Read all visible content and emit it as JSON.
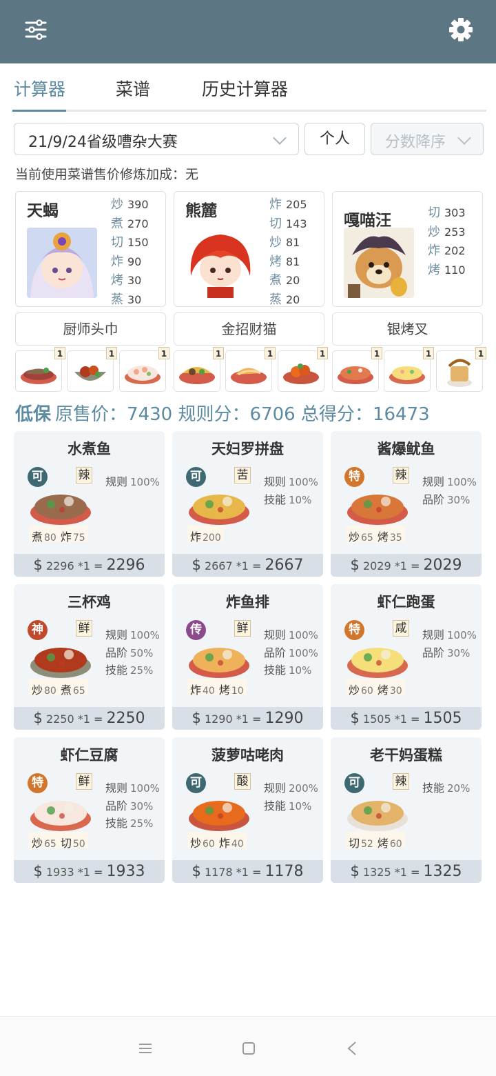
{
  "tabs": [
    "计算器",
    "菜谱",
    "历史计算器"
  ],
  "controls": {
    "rule_select": "21/9/24省级嘈杂大赛",
    "mode_button": "个人",
    "sort_select": "分数降序"
  },
  "bonus_note": "当前使用菜谱售价修炼加成：无",
  "chefs": [
    {
      "name": "天蝎",
      "skills": [
        {
          "k": "炒",
          "v": "390"
        },
        {
          "k": "煮",
          "v": "270"
        },
        {
          "k": "切",
          "v": "150"
        },
        {
          "k": "炸",
          "v": "90"
        },
        {
          "k": "烤",
          "v": "30"
        },
        {
          "k": "蒸",
          "v": "30"
        }
      ]
    },
    {
      "name": "熊麓",
      "skills": [
        {
          "k": "炸",
          "v": "205"
        },
        {
          "k": "切",
          "v": "143"
        },
        {
          "k": "炒",
          "v": "81"
        },
        {
          "k": "烤",
          "v": "81"
        },
        {
          "k": "煮",
          "v": "20"
        },
        {
          "k": "蒸",
          "v": "20"
        }
      ]
    },
    {
      "name": "嘎喵汪",
      "skills": [
        {
          "k": "切",
          "v": "303"
        },
        {
          "k": "炒",
          "v": "253"
        },
        {
          "k": "炸",
          "v": "202"
        },
        {
          "k": "烤",
          "v": "110"
        }
      ]
    }
  ],
  "equipment": [
    "厨师头巾",
    "金招财猫",
    "银烤叉"
  ],
  "ingredient_counts": [
    "1",
    "1",
    "1",
    "1",
    "1",
    "1",
    "1",
    "1",
    "1"
  ],
  "summary": {
    "label": "低保",
    "orig_label": "原售价：",
    "orig": "7430",
    "rule_label": "规则分：",
    "rule": "6706",
    "total_label": "总得分：",
    "total": "16473"
  },
  "recipes": [
    {
      "name": "水煮鱼",
      "rank": "可",
      "taste": "辣",
      "bonuses": [
        {
          "k": "规则",
          "p": "100%"
        }
      ],
      "req": [
        {
          "k": "煮",
          "v": "80"
        },
        {
          "k": "炸",
          "v": "75"
        }
      ],
      "price": "2296",
      "mult": "*1",
      "total": "2296"
    },
    {
      "name": "天妇罗拼盘",
      "rank": "可",
      "taste": "苦",
      "bonuses": [
        {
          "k": "规则",
          "p": "100%"
        },
        {
          "k": "技能",
          "p": "10%"
        }
      ],
      "req": [
        {
          "k": "炸",
          "v": "200"
        }
      ],
      "price": "2667",
      "mult": "*1",
      "total": "2667"
    },
    {
      "name": "酱爆鱿鱼",
      "rank": "特",
      "taste": "辣",
      "bonuses": [
        {
          "k": "规则",
          "p": "100%"
        },
        {
          "k": "品阶",
          "p": "30%"
        }
      ],
      "req": [
        {
          "k": "炒",
          "v": "65"
        },
        {
          "k": "烤",
          "v": "35"
        }
      ],
      "price": "2029",
      "mult": "*1",
      "total": "2029"
    },
    {
      "name": "三杯鸡",
      "rank": "神",
      "taste": "鲜",
      "bonuses": [
        {
          "k": "规则",
          "p": "100%"
        },
        {
          "k": "品阶",
          "p": "50%"
        },
        {
          "k": "技能",
          "p": "25%"
        }
      ],
      "req": [
        {
          "k": "炒",
          "v": "80"
        },
        {
          "k": "煮",
          "v": "65"
        }
      ],
      "price": "2250",
      "mult": "*1",
      "total": "2250"
    },
    {
      "name": "炸鱼排",
      "rank": "传",
      "taste": "鲜",
      "bonuses": [
        {
          "k": "规则",
          "p": "100%"
        },
        {
          "k": "品阶",
          "p": "100%"
        },
        {
          "k": "技能",
          "p": "10%"
        }
      ],
      "req": [
        {
          "k": "炸",
          "v": "40"
        },
        {
          "k": "烤",
          "v": "10"
        }
      ],
      "price": "1290",
      "mult": "*1",
      "total": "1290"
    },
    {
      "name": "虾仁跑蛋",
      "rank": "特",
      "taste": "咸",
      "bonuses": [
        {
          "k": "规则",
          "p": "100%"
        },
        {
          "k": "品阶",
          "p": "30%"
        }
      ],
      "req": [
        {
          "k": "炒",
          "v": "60"
        },
        {
          "k": "烤",
          "v": "30"
        }
      ],
      "price": "1505",
      "mult": "*1",
      "total": "1505"
    },
    {
      "name": "虾仁豆腐",
      "rank": "特",
      "taste": "鲜",
      "bonuses": [
        {
          "k": "规则",
          "p": "100%"
        },
        {
          "k": "品阶",
          "p": "30%"
        },
        {
          "k": "技能",
          "p": "25%"
        }
      ],
      "req": [
        {
          "k": "炒",
          "v": "65"
        },
        {
          "k": "切",
          "v": "50"
        }
      ],
      "price": "1933",
      "mult": "*1",
      "total": "1933"
    },
    {
      "name": "菠萝咕咾肉",
      "rank": "可",
      "taste": "酸",
      "bonuses": [
        {
          "k": "规则",
          "p": "200%"
        },
        {
          "k": "技能",
          "p": "10%"
        }
      ],
      "req": [
        {
          "k": "炒",
          "v": "60"
        },
        {
          "k": "炸",
          "v": "40"
        }
      ],
      "price": "1178",
      "mult": "*1",
      "total": "1178"
    },
    {
      "name": "老干妈蛋糕",
      "rank": "可",
      "taste": "辣",
      "bonuses": [
        {
          "k": "技能",
          "p": "20%"
        }
      ],
      "req": [
        {
          "k": "切",
          "v": "52"
        },
        {
          "k": "烤",
          "v": "60"
        }
      ],
      "price": "1325",
      "mult": "*1",
      "total": "1325"
    }
  ],
  "price_symbol": "$"
}
